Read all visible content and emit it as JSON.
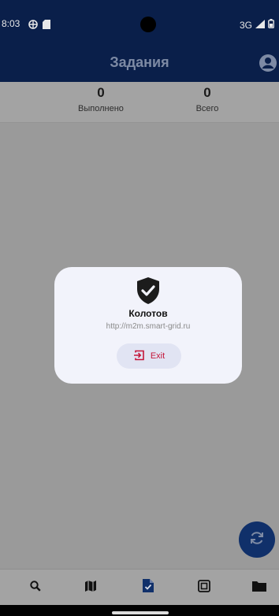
{
  "status_bar": {
    "time": "8:03",
    "network": "3G"
  },
  "header": {
    "title": "Задания"
  },
  "stats": {
    "done": {
      "value": "0",
      "label": "Выполнено"
    },
    "total": {
      "value": "0",
      "label": "Всего"
    }
  },
  "dialog": {
    "name": "Колотов",
    "url": "http://m2m.smart-grid.ru",
    "exit_label": "Exit"
  },
  "bottom_nav": {
    "items": [
      "search-icon",
      "map-icon",
      "task-check-icon",
      "meter-icon",
      "folder-icon"
    ],
    "active": "task-check-icon"
  },
  "colors": {
    "primary": "#0a1f4a",
    "fab": "#10306a",
    "danger": "#c4163a",
    "overlay": "#9a9a9a"
  }
}
